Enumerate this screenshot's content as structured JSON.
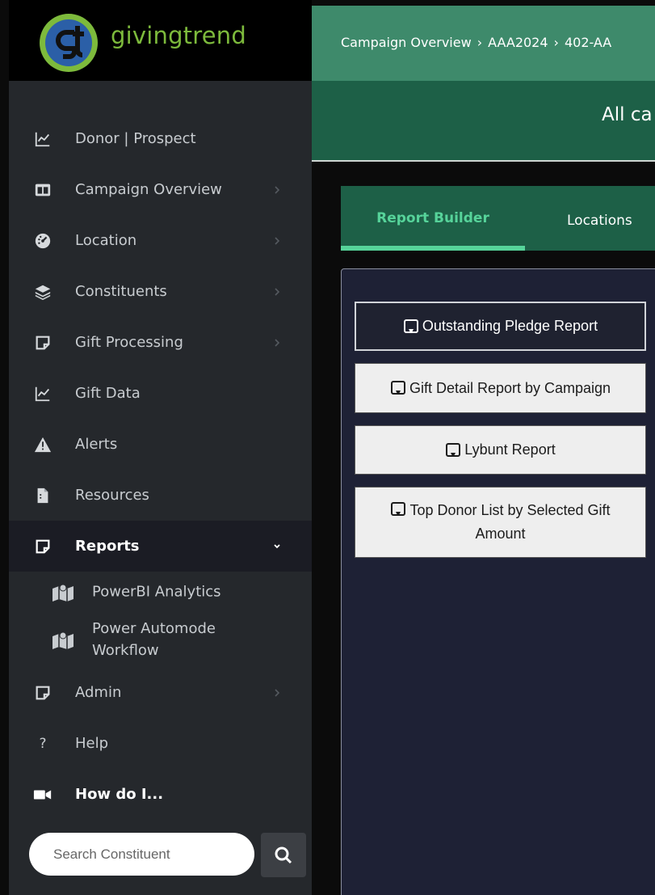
{
  "brand": {
    "name": "givingtrend",
    "logo_letters": "gt",
    "colors": {
      "blue": "#2b5fa7",
      "green": "#7dba3c"
    }
  },
  "sidebar": {
    "items": [
      {
        "label": "Donor | Prospect",
        "icon": "line-chart-icon",
        "chevron": false
      },
      {
        "label": "Campaign Overview",
        "icon": "columns-icon",
        "chevron": true
      },
      {
        "label": "Location",
        "icon": "dashboard-gauge-icon",
        "chevron": true
      },
      {
        "label": "Constituents",
        "icon": "layers-icon",
        "chevron": true
      },
      {
        "label": "Gift Processing",
        "icon": "sticky-note-icon",
        "chevron": true
      },
      {
        "label": "Gift Data",
        "icon": "line-chart-icon",
        "chevron": false
      },
      {
        "label": "Alerts",
        "icon": "warning-icon",
        "chevron": false
      },
      {
        "label": "Resources",
        "icon": "document-icon",
        "chevron": false
      },
      {
        "label": "Reports",
        "icon": "sticky-note-icon",
        "chevron": true,
        "expanded": true
      }
    ],
    "reports_children": [
      {
        "label": "PowerBI Analytics",
        "icon": "map-icon"
      },
      {
        "label_line1": "Power Automode",
        "label_line2": "Workflow",
        "icon": "map-icon"
      }
    ],
    "items_after": [
      {
        "label": "Admin",
        "icon": "sticky-note-icon",
        "chevron": true
      },
      {
        "label": "Help",
        "icon": "question-icon",
        "chevron": false
      },
      {
        "label": "How do I...",
        "icon": "video-camera-icon",
        "chevron": false
      }
    ],
    "search": {
      "placeholder": "Search Constituent",
      "value": ""
    }
  },
  "topbar": {
    "breadcrumb": [
      "Campaign Overview",
      "AAA2024",
      "402-AA"
    ]
  },
  "header": {
    "title": "All ca"
  },
  "tabs": [
    {
      "label": "Report Builder",
      "active": true
    },
    {
      "label": "Locations",
      "active": false
    }
  ],
  "reports": [
    {
      "label": "Outstanding Pledge Report",
      "selected": true
    },
    {
      "label": "Gift Detail Report by Campaign",
      "selected": false
    },
    {
      "label": "Lybunt Report",
      "selected": false
    },
    {
      "label_line1": "Top Donor List by Selected Gift",
      "label_line2": "Amount",
      "selected": false
    }
  ],
  "colors": {
    "sidebar_bg": "#25282c",
    "topbar_bg": "#3e8a6b",
    "header_bg": "#1d6047",
    "tab_active": "#56d39a",
    "panel_bg": "#1e2135"
  }
}
